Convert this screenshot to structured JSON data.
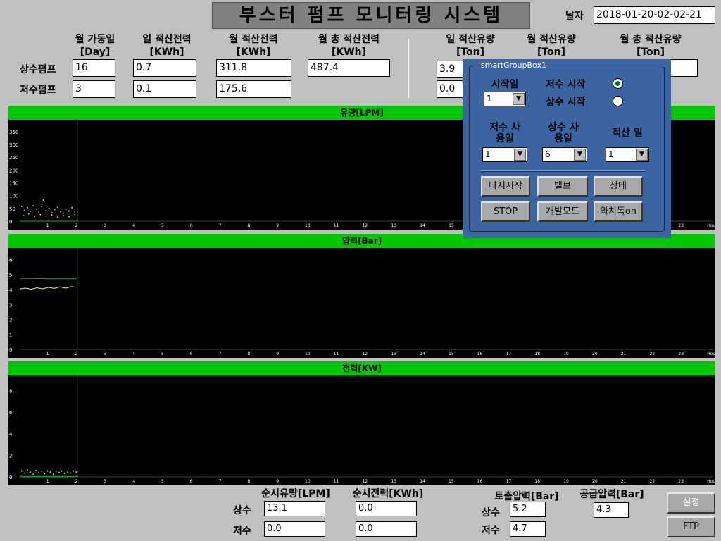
{
  "title": "부스터 펌프 모니터링 시스템",
  "date": {
    "label": "날자",
    "value": "2018-01-20-02-02-21"
  },
  "headers": {
    "monthly_days": "월 가동일\n[Day]",
    "daily_power": "일 적산전력\n[KWh]",
    "monthly_power": "월 적산전력\n[KWh]",
    "total_power": "월 총 적산전력\n[KWh]",
    "daily_flow": "일 적산유량\n[Ton]",
    "monthly_flow": "월 적산유량\n[Ton]",
    "total_flow": "월 총 적산유량\n[Ton]"
  },
  "rows": {
    "upper": {
      "label": "상수펌프",
      "days": "16",
      "daily_power": "0.7",
      "monthly_power": "311.8",
      "total_power": "487.4",
      "daily_flow": "3.9"
    },
    "lower": {
      "label": "저수펌프",
      "days": "3",
      "daily_power": "0.1",
      "monthly_power": "175.6",
      "daily_flow": "0.0"
    }
  },
  "charts": {
    "flow": {
      "title": "유량[LPM]"
    },
    "pressure": {
      "title": "압력[Bar]"
    },
    "power": {
      "title": "전력[KW]"
    }
  },
  "chart_data": [
    {
      "type": "scatter",
      "title": "유량[LPM]",
      "x_ticks": [
        "1",
        "2",
        "3",
        "4",
        "5",
        "6",
        "7",
        "8",
        "9",
        "10",
        "11",
        "12",
        "13",
        "14",
        "15",
        "16",
        "17",
        "18",
        "19",
        "20",
        "21",
        "22",
        "23",
        "Hour"
      ],
      "y_ticks": [
        "0",
        "50",
        "100",
        "150",
        "200",
        "250",
        "300",
        "350"
      ],
      "ylim": [
        0,
        380
      ],
      "xlim": [
        0,
        24
      ],
      "cursor_x": 2,
      "series": [
        {
          "color": "#ffff80",
          "points": [
            [
              0.05,
              60
            ],
            [
              0.15,
              45
            ],
            [
              0.25,
              55
            ],
            [
              0.35,
              40
            ],
            [
              0.45,
              62
            ],
            [
              0.55,
              50
            ],
            [
              0.65,
              38
            ],
            [
              0.75,
              58
            ],
            [
              0.8,
              85
            ],
            [
              0.9,
              44
            ],
            [
              1.0,
              52
            ],
            [
              1.1,
              35
            ],
            [
              1.2,
              48
            ],
            [
              1.3,
              57
            ],
            [
              1.4,
              40
            ],
            [
              1.5,
              33
            ],
            [
              1.6,
              50
            ],
            [
              1.7,
              42
            ],
            [
              1.8,
              55
            ],
            [
              1.9,
              38
            ]
          ]
        },
        {
          "color": "#ffff80",
          "points": [
            [
              0.1,
              25
            ],
            [
              0.3,
              30
            ],
            [
              0.5,
              20
            ],
            [
              0.7,
              28
            ],
            [
              0.9,
              22
            ],
            [
              1.1,
              26
            ],
            [
              1.3,
              18
            ],
            [
              1.5,
              24
            ],
            [
              1.7,
              20
            ],
            [
              1.9,
              27
            ]
          ]
        }
      ],
      "baseline": {
        "color": "#00c000",
        "value": 0
      }
    },
    {
      "type": "line",
      "title": "압력[Bar]",
      "x_ticks": [
        "1",
        "2",
        "3",
        "4",
        "5",
        "6",
        "7",
        "8",
        "9",
        "10",
        "11",
        "12",
        "13",
        "14",
        "15",
        "16",
        "17",
        "18",
        "19",
        "20",
        "21",
        "22",
        "23",
        "Hour"
      ],
      "y_ticks": [
        "0",
        "1",
        "2",
        "3",
        "4",
        "5",
        "6"
      ],
      "ylim": [
        0,
        6.5
      ],
      "xlim": [
        0,
        24
      ],
      "cursor_x": 2,
      "series": [
        {
          "color": "#00c000",
          "points": [
            [
              0,
              4.75
            ],
            [
              0.5,
              4.74
            ],
            [
              1,
              4.72
            ],
            [
              1.5,
              4.73
            ],
            [
              2,
              4.72
            ]
          ]
        },
        {
          "color": "#ffff40",
          "points": [
            [
              0,
              4.05
            ],
            [
              0.2,
              4.1
            ],
            [
              0.4,
              4.02
            ],
            [
              0.6,
              4.12
            ],
            [
              0.8,
              4.05
            ],
            [
              1.0,
              4.15
            ],
            [
              1.2,
              4.08
            ],
            [
              1.4,
              4.18
            ],
            [
              1.6,
              4.1
            ],
            [
              1.8,
              4.2
            ],
            [
              2.0,
              4.15
            ]
          ]
        }
      ]
    },
    {
      "type": "scatter",
      "title": "전력[KW]",
      "x_ticks": [
        "1",
        "2",
        "3",
        "4",
        "5",
        "6",
        "7",
        "8",
        "9",
        "10",
        "11",
        "12",
        "13",
        "14",
        "15",
        "16",
        "17",
        "18",
        "19",
        "20",
        "21",
        "22",
        "23",
        "Hour"
      ],
      "y_ticks": [
        "0",
        "2",
        "4",
        "6",
        "8"
      ],
      "ylim": [
        0,
        9
      ],
      "xlim": [
        0,
        24
      ],
      "cursor_x": 2,
      "series": [
        {
          "color": "#ffff80",
          "points": [
            [
              0.05,
              0.6
            ],
            [
              0.15,
              0.4
            ],
            [
              0.25,
              0.7
            ],
            [
              0.35,
              0.5
            ],
            [
              0.45,
              0.3
            ],
            [
              0.55,
              0.65
            ],
            [
              0.65,
              0.45
            ],
            [
              0.75,
              0.55
            ],
            [
              0.85,
              0.35
            ],
            [
              0.95,
              0.6
            ],
            [
              1.05,
              0.5
            ],
            [
              1.15,
              0.3
            ],
            [
              1.25,
              0.55
            ],
            [
              1.35,
              0.45
            ],
            [
              1.45,
              0.6
            ],
            [
              1.55,
              0.35
            ],
            [
              1.65,
              0.5
            ],
            [
              1.75,
              0.4
            ],
            [
              1.85,
              0.6
            ],
            [
              1.95,
              0.5
            ]
          ]
        }
      ],
      "baseline": {
        "color": "#00c000",
        "value": 0.05
      }
    }
  ],
  "groupbox": {
    "title": "smartGroupBox1",
    "start_day_label": "시작일",
    "start_day_value": "1",
    "lower_start": "저수 시작",
    "upper_start": "상수 시작",
    "lower_use_label": "저수 사\n용일",
    "lower_use_value": "1",
    "upper_use_label": "상수 사\n용일",
    "upper_use_value": "6",
    "acc_day_label": "적산 일",
    "acc_day_value": "1",
    "buttons": {
      "restart": "다시시작",
      "valve": "밸브",
      "status": "상태",
      "stop": "STOP",
      "dev": "개발모드",
      "wachi": "와치독on"
    }
  },
  "bottom": {
    "inst_flow_label": "순시유량[LPM]",
    "inst_power_label": "순시전력[KWh]",
    "discharge_label": "토출압력[Bar]",
    "supply_label": "공급압력[Bar]",
    "upper_label": "상수",
    "lower_label": "저수",
    "upper_flow": "13.1",
    "upper_power": "0.0",
    "lower_flow": "0.0",
    "lower_power": "0.0",
    "upper_discharge": "5.2",
    "lower_discharge": "4.7",
    "supply": "4.3",
    "settings_button": "설정",
    "ftp_button": "FTP"
  }
}
